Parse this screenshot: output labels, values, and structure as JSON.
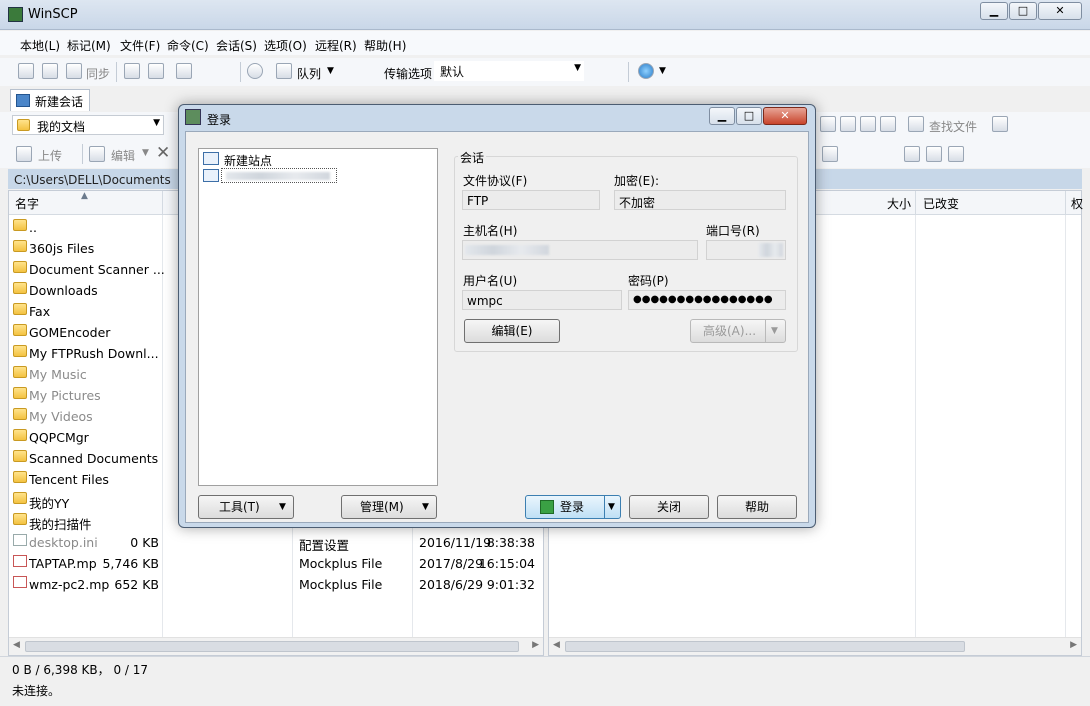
{
  "window": {
    "title": "WinSCP",
    "min": "▁",
    "max": "□",
    "close": "✕"
  },
  "menu": [
    "本地(L)",
    "标记(M)",
    "文件(F)",
    "命令(C)",
    "会话(S)",
    "选项(O)",
    "远程(R)",
    "帮助(H)"
  ],
  "toolbar1": {
    "sync": "同步",
    "queue": "队列",
    "transfer_label": "传输选项",
    "transfer_value": "默认"
  },
  "session_tab": "新建会话",
  "left": {
    "location": "我的文档",
    "upload": "上传",
    "edit": "编辑",
    "path": "C:\\Users\\DELL\\Documents",
    "col_name": "名字",
    "files": [
      {
        "name": "..",
        "size": "",
        "type": "",
        "date": "",
        "time": "",
        "kind": "up"
      },
      {
        "name": "360js Files",
        "kind": "folder"
      },
      {
        "name": "Document Scanner ...",
        "kind": "folder"
      },
      {
        "name": "Downloads",
        "kind": "folder"
      },
      {
        "name": "Fax",
        "kind": "folder"
      },
      {
        "name": "GOMEncoder",
        "kind": "folder"
      },
      {
        "name": "My FTPRush Downl...",
        "kind": "folder"
      },
      {
        "name": "My Music",
        "kind": "folder",
        "gray": true
      },
      {
        "name": "My Pictures",
        "kind": "folder",
        "gray": true
      },
      {
        "name": "My Videos",
        "kind": "folder",
        "gray": true
      },
      {
        "name": "QQPCMgr",
        "kind": "folder"
      },
      {
        "name": "Scanned Documents",
        "kind": "folder"
      },
      {
        "name": "Tencent Files",
        "kind": "folder"
      },
      {
        "name": "我的YY",
        "kind": "folder"
      },
      {
        "name": "我的扫描件",
        "kind": "folder"
      },
      {
        "name": "desktop.ini",
        "size": "0 KB",
        "type": "配置设置",
        "date": "2016/11/19",
        "time": "8:38:38",
        "kind": "file",
        "gray": true
      },
      {
        "name": "TAPTAP.mp",
        "size": "5,746 KB",
        "type": "Mockplus File",
        "date": "2017/8/29",
        "time": "16:15:04",
        "kind": "mp"
      },
      {
        "name": "wmz-pc2.mp",
        "size": "652 KB",
        "type": "Mockplus File",
        "date": "2018/6/29",
        "time": "9:01:32",
        "kind": "mp"
      }
    ]
  },
  "right": {
    "find_files": "查找文件",
    "col_size": "大小",
    "col_changed": "已改变",
    "col_extra": "权"
  },
  "status": {
    "line1": "0 B / 6,398 KB， 0 / 17",
    "line2": "未连接。"
  },
  "dialog": {
    "title": "登录",
    "tree_new_site": "新建站点",
    "group_title": "会话",
    "protocol_label": "文件协议(F)",
    "protocol_value": "FTP",
    "encrypt_label": "加密(E):",
    "encrypt_value": "不加密",
    "host_label": "主机名(H)",
    "port_label": "端口号(R)",
    "user_label": "用户名(U)",
    "user_value": "wmpc",
    "pass_label": "密码(P)",
    "pass_value": "●●●●●●●●●●●●●●●●",
    "edit_button": "编辑(E)",
    "advanced_button": "高级(A)...",
    "tools_button": "工具(T)",
    "manage_button": "管理(M)",
    "login_button": "登录",
    "close_button": "关闭",
    "help_button": "帮助"
  }
}
